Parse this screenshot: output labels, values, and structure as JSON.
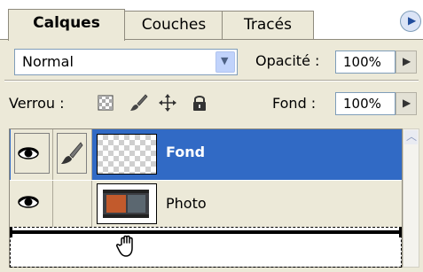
{
  "tabs": [
    {
      "label": "Calques",
      "active": true
    },
    {
      "label": "Couches",
      "active": false
    },
    {
      "label": "Tracés",
      "active": false
    }
  ],
  "blend_mode": {
    "value": "Normal"
  },
  "opacity": {
    "label": "Opacité :",
    "value": "100%"
  },
  "lock": {
    "label": "Verrou :",
    "icons": [
      "transparency-lock-icon",
      "brush-lock-icon",
      "move-lock-icon",
      "padlock-icon"
    ]
  },
  "fill": {
    "label": "Fond :",
    "value": "100%"
  },
  "layers": [
    {
      "name": "Fond",
      "selected": true,
      "visible": true,
      "thumbnail": "transparent-checker"
    },
    {
      "name": "Photo",
      "selected": false,
      "visible": true,
      "thumbnail": "photo"
    }
  ],
  "colors": {
    "selection": "#316ac5",
    "panel": "#ece9d8"
  }
}
